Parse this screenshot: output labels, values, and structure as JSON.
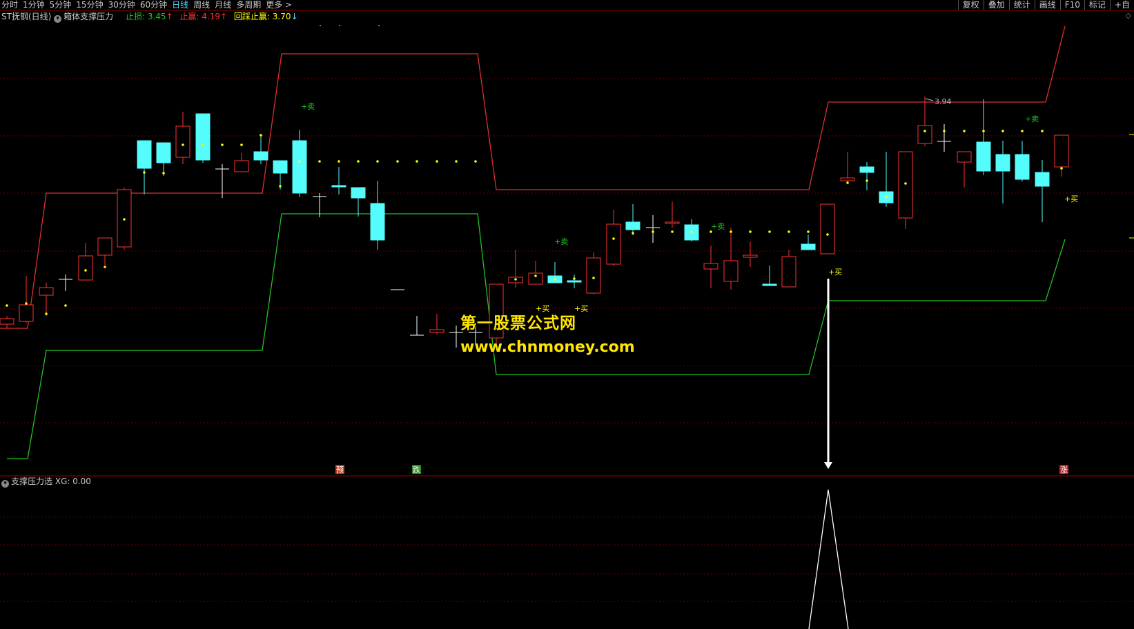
{
  "toolbar": {
    "tabs": [
      "分时",
      "1分钟",
      "5分钟",
      "15分钟",
      "30分钟",
      "60分钟",
      "日线",
      "周线",
      "月线",
      "多周期",
      "更多 >"
    ],
    "active_tab": "日线",
    "tools": [
      "复权",
      "叠加",
      "统计",
      "画线",
      "F10",
      "标记",
      "+自"
    ]
  },
  "info": {
    "stock": "ST抚钢(日线)",
    "indicator": "箱体支撑压力",
    "stop_loss": "止损: 3.45",
    "stop_loss_arrow": "↑",
    "take_profit": "止赢: 4.19",
    "take_profit_arrow": "↑",
    "pullback": "回踩止赢: 3.70",
    "pullback_arrow": "↓",
    "diamond": "◇"
  },
  "lower": {
    "indicator": "支撑压力选",
    "value": "XG: 0.00"
  },
  "labels": {
    "sell": "+卖",
    "buy": "+买",
    "pre": "预",
    "down": "跌",
    "up": "涨",
    "high_mark": "3.94"
  },
  "watermark": {
    "line1": "第一股票公式网",
    "line2": "www.chnmoney.com"
  },
  "colors": {
    "up": "#ff3232",
    "down": "#54fcfc",
    "resistance": "#e03030",
    "support": "#22c322",
    "grid": "#6e0000",
    "dot": "#ffff00",
    "sell_label": "#22c322",
    "buy_label": "#ffff00"
  }
}
